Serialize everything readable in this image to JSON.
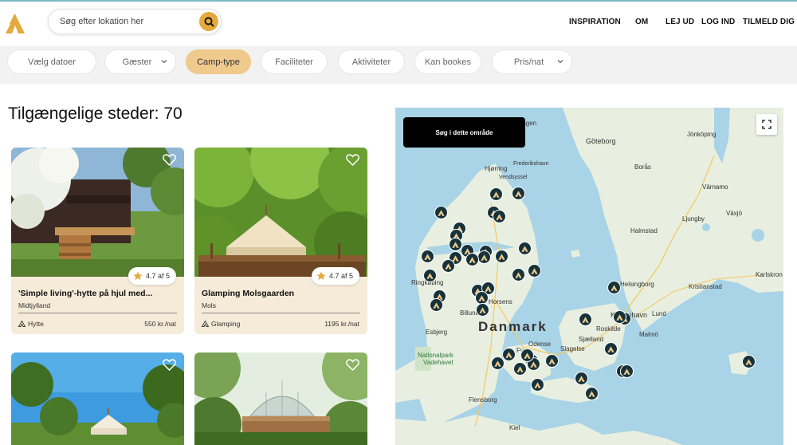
{
  "header": {
    "search_placeholder": "Søg efter lokation her",
    "nav": [
      "INSPIRATION",
      "OM",
      "LEJ UD",
      "LOG IND",
      "TILMELD DIG"
    ]
  },
  "filters": [
    {
      "label": "Vælg datoer",
      "dropdown": false,
      "active": false
    },
    {
      "label": "Gæster",
      "dropdown": true,
      "active": false
    },
    {
      "label": "Camp-type",
      "dropdown": false,
      "active": true
    },
    {
      "label": "Faciliteter",
      "dropdown": false,
      "active": false
    },
    {
      "label": "Aktiviteter",
      "dropdown": false,
      "active": false
    },
    {
      "label": "Kan bookes",
      "dropdown": false,
      "active": false
    },
    {
      "label": "Pris/nat",
      "dropdown": true,
      "active": false
    }
  ],
  "results": {
    "heading": "Tilgængelige steder: 70"
  },
  "listings": [
    {
      "rating": "4.7 af 5",
      "title": "'Simple living'-hytte på hjul med...",
      "location": "Midtjylland",
      "type": "Hytte",
      "price": "550 kr./nat"
    },
    {
      "rating": "4.7 af 5",
      "title": "Glamping Molsgaarden",
      "location": "Mols",
      "type": "Glamping",
      "price": "1195 kr./nat"
    }
  ],
  "map": {
    "search_area_label": "Søg i dette område",
    "labels": {
      "country": "Danmark",
      "goteborg": "Göteborg",
      "jonkoping": "Jönköping",
      "borås": "Borås",
      "varnamo": "Värnamo",
      "vaxjo": "Växjö",
      "ljungby": "Ljungby",
      "halmstad": "Halmstad",
      "skagen": "Skagen",
      "frederikshavn": "Frederikshavn",
      "hjorring": "Hjørring",
      "vendsyssel": "Vendsyssel",
      "ringkobing": "Ringkøbing",
      "horsens": "Horsens",
      "billund": "Billund",
      "esbjerg": "Esbjerg",
      "odense": "Odense",
      "fyn": "Fyn",
      "slagelse": "Slagelse",
      "sjaelland": "Sjælland",
      "roskilde": "Roskilde",
      "kobenhavn": "København",
      "helsingborg": "Helsingborg",
      "lund": "Lund",
      "malmo": "Malmö",
      "kristianstad": "Kristianstad",
      "karlskrona": "Karlskron",
      "flensborg": "Flensborg",
      "kiel": "Kiel",
      "nationalpark": "Nationalpark",
      "vadehavet": "Vadehavet"
    },
    "pin_count": 44
  },
  "colors": {
    "accent": "#e5a93d",
    "active_chip": "#f0c98c",
    "card_bg": "#f6ebd9",
    "map_pin": "#16323a",
    "sea": "#a9d3e6",
    "land": "#e9efe3"
  }
}
